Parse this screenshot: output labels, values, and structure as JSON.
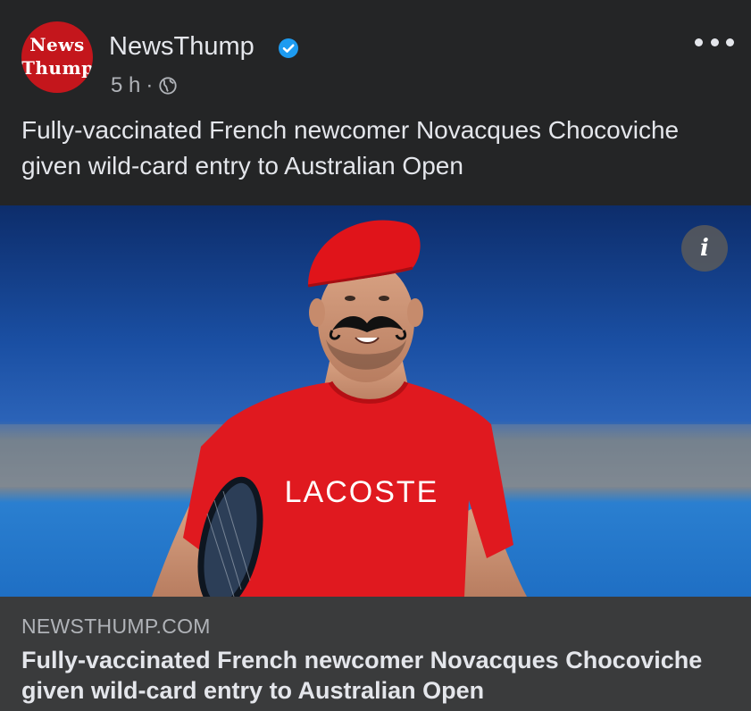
{
  "header": {
    "avatar_text_line1": "News",
    "avatar_text_line2": "Thump",
    "page_name": "NewsThump",
    "time": "5 h",
    "separator": "·"
  },
  "post": {
    "text": "Fully-vaccinated French newcomer Novacques Chocoviche given wild-card entry to Australian Open",
    "image_shirt_text": "LACOSTE"
  },
  "link_preview": {
    "domain": "NEWSTHUMP.COM",
    "title": "Fully-vaccinated French newcomer Novacques Chocoviche given wild-card entry to Australian Open"
  },
  "icons": {
    "verified": "verified-badge-icon",
    "audience": "globe-icon",
    "more": "more-options-icon",
    "info": "info-icon"
  },
  "colors": {
    "background": "#242526",
    "preview_background": "#3a3b3c",
    "verified_blue": "#1d9bf0",
    "brand_red": "#c4161c"
  }
}
